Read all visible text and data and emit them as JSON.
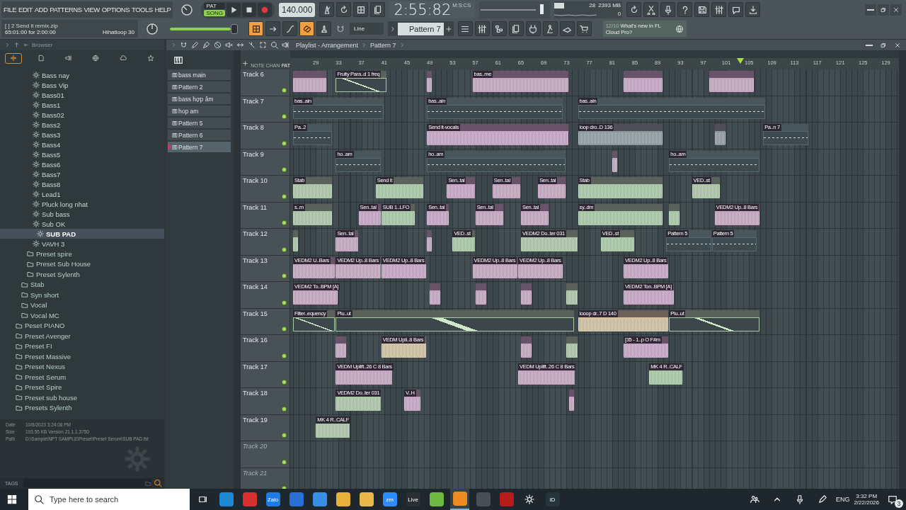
{
  "menu": [
    "FILE",
    "EDIT",
    "ADD",
    "PATTERNS",
    "VIEW",
    "OPTIONS",
    "TOOLS",
    "HELP"
  ],
  "transport": {
    "modes": [
      {
        "label": "PAT",
        "selected": false
      },
      {
        "label": "SONG",
        "selected": true
      }
    ],
    "tempo": "140.000",
    "time": "2:55:82",
    "time_unit": "M:S:CS"
  },
  "hint": {
    "title": "[ ]  2 Send it remix.zip",
    "position": "65:01:00 for 2:00:00",
    "channel": "Hihatloop 30"
  },
  "monitor": {
    "cpu": "28",
    "memory": "2393 MB",
    "polyphony": "0"
  },
  "master_volume": {
    "level": 0.93
  },
  "snap": "Line",
  "pattern_selector": "Pattern 7",
  "news": {
    "count": "12/10",
    "text": "What's new in FL Cloud Pro?"
  },
  "browser": {
    "title": "Browser",
    "tabs": [
      {
        "selected": true
      },
      {
        "selected": false
      },
      {
        "selected": false
      },
      {
        "selected": false
      },
      {
        "selected": false
      },
      {
        "selected": false
      }
    ],
    "tree": [
      {
        "children": [
          {
            "children": [
              {
                "children": [
                  {
                    "kind": "preset",
                    "label": "Bass nay",
                    "selected": false
                  },
                  {
                    "kind": "preset",
                    "label": "Bass Vip",
                    "selected": false
                  },
                  {
                    "kind": "preset",
                    "label": "Bass01",
                    "selected": false
                  },
                  {
                    "kind": "preset",
                    "label": "Bass1",
                    "selected": false
                  },
                  {
                    "kind": "preset",
                    "label": "Bass02",
                    "selected": false
                  },
                  {
                    "kind": "preset",
                    "label": "Bass2",
                    "selected": false
                  },
                  {
                    "kind": "preset",
                    "label": "Bass3",
                    "selected": false
                  },
                  {
                    "kind": "preset",
                    "label": "Bass4",
                    "selected": false
                  },
                  {
                    "kind": "preset",
                    "label": "Bass5",
                    "selected": false
                  },
                  {
                    "kind": "preset",
                    "label": "Bass6",
                    "selected": false
                  },
                  {
                    "kind": "preset",
                    "label": "Bass7",
                    "selected": false
                  },
                  {
                    "kind": "preset",
                    "label": "Bass8",
                    "selected": false
                  },
                  {
                    "kind": "preset",
                    "label": "Lead1",
                    "selected": false
                  },
                  {
                    "kind": "preset",
                    "label": "Pluck long nhat",
                    "selected": false
                  },
                  {
                    "kind": "preset",
                    "label": "Sub bass",
                    "selected": false
                  },
                  {
                    "kind": "preset",
                    "label": "Sub OK",
                    "selected": false
                  },
                  {
                    "kind": "preset",
                    "label": "SUB PAD",
                    "selected": true
                  },
                  {
                    "kind": "preset",
                    "label": "VAVH 3",
                    "selected": false
                  }
                ]
              },
              {
                "kind": "folder",
                "label": "Preset spire",
                "selected": false
              },
              {
                "kind": "folder",
                "label": "Preset Sub House",
                "selected": false
              },
              {
                "kind": "folder",
                "label": "Preset Sylenth",
                "selected": false
              }
            ]
          },
          {
            "kind": "folder",
            "label": "Stab",
            "selected": false
          },
          {
            "kind": "folder",
            "label": "Syn short",
            "selected": false
          },
          {
            "kind": "folder",
            "label": "Vocal",
            "selected": false
          },
          {
            "kind": "folder",
            "label": "Vocal MC",
            "selected": false
          }
        ]
      },
      {
        "kind": "folder",
        "label": "Peset PIANO",
        "selected": false
      },
      {
        "kind": "folder",
        "label": "Preset Avenger",
        "selected": false
      },
      {
        "kind": "folder",
        "label": "Preset FI",
        "selected": false
      },
      {
        "kind": "folder",
        "label": "Preset Massive",
        "selected": false
      },
      {
        "kind": "folder",
        "label": "Preset Nexus",
        "selected": false
      },
      {
        "kind": "folder",
        "label": "Preset Serum",
        "selected": false
      },
      {
        "kind": "folder",
        "label": "Preset Spire",
        "selected": false
      },
      {
        "kind": "folder",
        "label": "Preset sub house",
        "selected": false
      },
      {
        "kind": "folder",
        "label": "Presets Sylenth",
        "selected": false
      }
    ],
    "info": [
      {
        "label": "Date",
        "value": "10/8/2023 3:24:08 PM"
      },
      {
        "label": "Size",
        "value": "193.55 KB   Version 21.1.1.3750"
      },
      {
        "label": "Path",
        "value": "D:\\Sample\\NPT SAMPLE\\Preset\\Preset Serum\\SUB PAD.fst"
      }
    ],
    "tags_label": "TAGS"
  },
  "playlist": {
    "title": "Playlist - Arrangement",
    "pattern": "Pattern 7",
    "patterns": [
      {
        "label": "bass main",
        "selected": false
      },
      {
        "label": "Pattern 2",
        "selected": false
      },
      {
        "label": "bass hợp  âm",
        "selected": false
      },
      {
        "label": "hop am",
        "selected": false
      },
      {
        "label": "Pattern 5",
        "selected": false
      },
      {
        "label": "Pattern 6",
        "selected": false
      },
      {
        "label": "Pattern 7",
        "selected": true
      }
    ],
    "view_tabs": [
      {
        "label": "NOTE",
        "selected": false
      },
      {
        "label": "CHAN",
        "selected": false
      },
      {
        "label": "PAT",
        "selected": true
      }
    ],
    "ruler": [
      "29",
      "33",
      "37",
      "41",
      "45",
      "49",
      "53",
      "57",
      "61",
      "65",
      "69",
      "73",
      "77",
      "81",
      "85",
      "89",
      "93",
      "97",
      "101",
      "105",
      "109",
      "113",
      "117",
      "121",
      "125",
      "129"
    ],
    "playhead": {
      "level": 0.74
    },
    "tracks": [
      {
        "name": "Track 6",
        "dimmed": false,
        "clips": [
          {
            "kind": "audio",
            "color": "#c9a3c4"
          },
          {
            "kind": "automation",
            "label": "Fruity Para..d 1 freq",
            "color": "#a9c9a4"
          },
          {
            "kind": "audio",
            "color": "#c9a3c4"
          },
          {
            "kind": "audio",
            "label": "bas..me",
            "color": "#c9a3c4"
          },
          {
            "kind": "audio",
            "color": "#c9a3c4"
          },
          {
            "kind": "audio",
            "color": "#c9a3c4"
          }
        ]
      },
      {
        "name": "Track 7",
        "dimmed": false,
        "clips": [
          {
            "kind": "pattern",
            "label": "bas..ain",
            "color": "#56666d"
          },
          {
            "kind": "pattern",
            "label": "bas..ain",
            "color": "#56666d"
          },
          {
            "kind": "pattern",
            "label": "bas..ain",
            "color": "#56666d"
          }
        ]
      },
      {
        "name": "Track 8",
        "dimmed": false,
        "clips": [
          {
            "kind": "pattern",
            "label": "Pa..2",
            "color": "#56666d"
          },
          {
            "kind": "audio",
            "label": "Send it-vocals",
            "color": "#c9a3c4"
          },
          {
            "kind": "audio",
            "label": "loop dro..D 136",
            "color": "#8b979c"
          },
          {
            "kind": "audio",
            "color": "#8b979c"
          },
          {
            "kind": "pattern",
            "label": "Pa..n 7",
            "color": "#56666d"
          }
        ]
      },
      {
        "name": "Track 9",
        "dimmed": false,
        "clips": [
          {
            "kind": "pattern",
            "label": "ho..am",
            "color": "#56666d"
          },
          {
            "kind": "pattern",
            "label": "ho..am",
            "color": "#56666d"
          },
          {
            "kind": "audio",
            "color": "#c9a3c4"
          },
          {
            "kind": "pattern",
            "label": "ho..am",
            "color": "#56666d"
          }
        ]
      },
      {
        "name": "Track 10",
        "dimmed": false,
        "clips": [
          {
            "kind": "audio",
            "label": "Stab",
            "color": "#a9c9a4"
          },
          {
            "kind": "audio",
            "label": "Send it",
            "color": "#a9c9a4"
          },
          {
            "kind": "audio",
            "label": "Sen..tal",
            "color": "#c9a3c4"
          },
          {
            "kind": "audio",
            "label": "Sen..tal",
            "color": "#c9a3c4"
          },
          {
            "kind": "audio",
            "label": "Sen..tal",
            "color": "#c9a3c4"
          },
          {
            "kind": "audio",
            "label": "Stab",
            "color": "#a9c9a4"
          },
          {
            "kind": "audio",
            "label": "VED..st",
            "color": "#a9c9a4"
          }
        ]
      },
      {
        "name": "Track 11",
        "dimmed": false,
        "clips": [
          {
            "kind": "audio",
            "label": "s..m",
            "color": "#a9c9a4"
          },
          {
            "kind": "audio",
            "label": "Sen..tal",
            "color": "#c9a3c4"
          },
          {
            "kind": "audio",
            "label": "SUB 1..LFO",
            "color": "#a9c9a4"
          },
          {
            "kind": "audio",
            "label": "Sen..tal",
            "color": "#c9a3c4"
          },
          {
            "kind": "audio",
            "label": "Sen..tal",
            "color": "#c9a3c4"
          },
          {
            "kind": "audio",
            "label": "Sen..tal",
            "color": "#c9a3c4"
          },
          {
            "kind": "audio",
            "label": "sy..dm",
            "color": "#a9c9a4"
          },
          {
            "kind": "audio",
            "color": "#a9c9a4"
          },
          {
            "kind": "audio",
            "label": "VEDM2 Up..8 Bars",
            "color": "#c9a3c4"
          }
        ]
      },
      {
        "name": "Track 12",
        "dimmed": false,
        "clips": [
          {
            "kind": "audio",
            "color": "#a9c9a4"
          },
          {
            "kind": "audio",
            "label": "Sen..tal",
            "color": "#c9a3c4"
          },
          {
            "kind": "audio",
            "color": "#c9a3c4"
          },
          {
            "kind": "audio",
            "label": "VED..st",
            "color": "#a9c9a4"
          },
          {
            "kind": "audio",
            "label": "VEDM2 Do..ter 031",
            "color": "#a9c9a4"
          },
          {
            "kind": "audio",
            "label": "VED..st",
            "color": "#a9c9a4"
          },
          {
            "kind": "pattern",
            "label": "Pattern 5",
            "color": "#56666d"
          },
          {
            "kind": "pattern",
            "label": "Pattern 5",
            "color": "#56666d"
          }
        ]
      },
      {
        "name": "Track 13",
        "dimmed": false,
        "clips": [
          {
            "kind": "audio",
            "label": "VEDM2 U..Bars",
            "color": "#c9a3c4"
          },
          {
            "kind": "audio",
            "label": "VEDM2 Up..8 Bars",
            "color": "#c9a3c4"
          },
          {
            "kind": "audio",
            "label": "VEDM2 Up..8 Bars",
            "color": "#c9a3c4"
          },
          {
            "kind": "audio",
            "label": "VEDM2 Up..8 Bars",
            "color": "#c9a3c4"
          },
          {
            "kind": "audio",
            "label": "VEDM2 Up..8 Bars",
            "color": "#c9a3c4"
          },
          {
            "kind": "audio",
            "label": "VEDM2 Up..8 Bars",
            "color": "#c9a3c4"
          }
        ]
      },
      {
        "name": "Track 14",
        "dimmed": false,
        "clips": [
          {
            "kind": "audio",
            "label": "VEDM2 To..BPM [A]",
            "color": "#c9a3c4"
          },
          {
            "kind": "audio",
            "color": "#c9a3c4"
          },
          {
            "kind": "audio",
            "color": "#c9a3c4"
          },
          {
            "kind": "audio",
            "color": "#c9a3c4"
          },
          {
            "kind": "audio",
            "color": "#a9c9a4"
          },
          {
            "kind": "audio",
            "label": "VEDM2 Ton..BPM [A]",
            "color": "#c9a3c4"
          }
        ]
      },
      {
        "name": "Track 15",
        "dimmed": false,
        "clips": [
          {
            "kind": "automation",
            "label": "Filter..equency",
            "color": "#a9c9a4"
          },
          {
            "kind": "automation",
            "label": "Plu..ut",
            "color": "#a9c9a4"
          },
          {
            "kind": "audio",
            "label": "looop dr..7 D 140",
            "color": "#d4c2a0"
          },
          {
            "kind": "automation",
            "label": "Plu..ut",
            "color": "#a9c9a4"
          }
        ]
      },
      {
        "name": "Track 16",
        "dimmed": false,
        "clips": [
          {
            "kind": "audio",
            "color": "#c9a3c4"
          },
          {
            "kind": "audio",
            "label": "VEDM Upli..8 Bars",
            "color": "#d4c2a0"
          },
          {
            "kind": "audio",
            "color": "#c9a3c4"
          },
          {
            "kind": "audio",
            "color": "#a9c9a4"
          },
          {
            "kind": "audio",
            "label": "[35 - 1..p O F#m",
            "color": "#c9a3c4"
          }
        ]
      },
      {
        "name": "Track 17",
        "dimmed": false,
        "clips": [
          {
            "kind": "audio",
            "label": "VEDM Uplift..26 C 8 Bars",
            "color": "#c9a3c4"
          },
          {
            "kind": "audio",
            "label": "VEDM Uplift..26 C 8 Bars",
            "color": "#c9a3c4"
          },
          {
            "kind": "audio",
            "label": "MK 4 R..CALF",
            "color": "#a9c9a4"
          }
        ]
      },
      {
        "name": "Track 18",
        "dimmed": false,
        "clips": [
          {
            "kind": "audio",
            "label": "VEDM2 Do..ter 031",
            "color": "#a9c9a4"
          },
          {
            "kind": "audio",
            "label": "V..H",
            "color": "#c9a3c4"
          },
          {
            "kind": "audio",
            "color": "#c9a3c4"
          }
        ]
      },
      {
        "name": "Track 19",
        "dimmed": false,
        "clips": [
          {
            "kind": "audio",
            "label": "MK 4 R..CALF",
            "color": "#a9c9a4"
          }
        ]
      },
      {
        "name": "Track 20",
        "dimmed": true
      },
      {
        "name": "Track 21",
        "dimmed": true
      }
    ]
  },
  "taskbar": {
    "search_placeholder": "Type here to search",
    "apps": [
      {
        "color": "#1e88d5",
        "selected": false
      },
      {
        "color": "#d63031",
        "selected": false
      },
      {
        "color": "#1e7be5",
        "label": "Zalo",
        "selected": false
      },
      {
        "color": "#2a6fd6",
        "selected": false
      },
      {
        "color": "#3a8ee6",
        "selected": false
      },
      {
        "color": "#e8b23a",
        "selected": false
      },
      {
        "color": "#e9b949",
        "selected": false
      },
      {
        "color": "#2d8cff",
        "label": "zm",
        "selected": false
      },
      {
        "color": "#2a2f33",
        "label": "Live",
        "selected": false
      },
      {
        "color": "#6fb83f",
        "selected": false
      },
      {
        "color": "#f08a24",
        "selected": true
      },
      {
        "color": "#4a4f55",
        "selected": false
      },
      {
        "color": "#b71c1c",
        "selected": false
      },
      {
        "color": "#26343b",
        "label": "iD",
        "selected": false
      }
    ],
    "language": "ENG",
    "time": "3:32 PM",
    "date": "2/22/2026",
    "notifications": "3"
  }
}
